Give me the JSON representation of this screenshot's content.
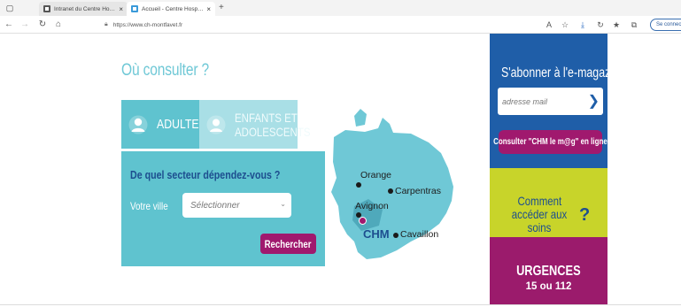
{
  "browser": {
    "tabs": [
      {
        "title": "Intranet du Centre Hospitalier M",
        "active": false
      },
      {
        "title": "Accueil - Centre Hospitalier Mon",
        "active": true
      }
    ],
    "url": "https://www.ch-montfavet.fr",
    "signin_label": "Se connecter"
  },
  "page": {
    "heading": "Où consulter ?",
    "tabs": {
      "adultes": "ADULTES",
      "enfants_line1": "ENFANTS ET",
      "enfants_line2": "ADOLESCENTS"
    },
    "search": {
      "title": "De quel secteur dépendez-vous ?",
      "city_label": "Votre ville",
      "city_placeholder": "Sélectionner",
      "button": "Rechercher"
    },
    "map": {
      "places": [
        "Orange",
        "Carpentras",
        "Avignon",
        "CHM",
        "Cavaillon"
      ]
    },
    "magazine": {
      "title": "S'abonner à l'e-magazine",
      "email_placeholder": "adresse mail",
      "button": "Consulter \"CHM le m@g\" en ligne"
    },
    "access": {
      "line1": "Comment",
      "line2": "accéder aux soins",
      "icon": "?"
    },
    "urgences": {
      "title": "URGENCES",
      "numbers": "15 ou 112"
    }
  },
  "colors": {
    "teal": "#5fc3cf",
    "light_teal": "#a9dfe6",
    "navy": "#1d4e8f",
    "plum": "#a0196e",
    "lime": "#c8d42a",
    "blue": "#1f5ea8"
  }
}
